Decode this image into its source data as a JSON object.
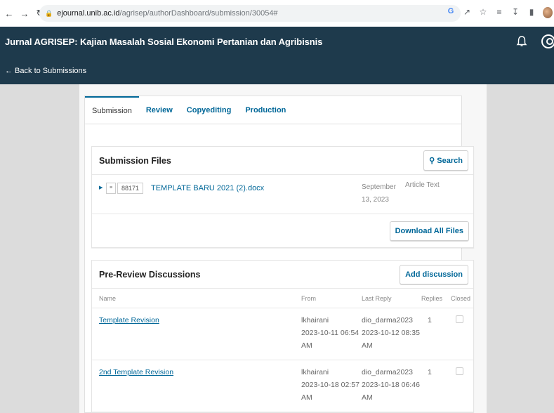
{
  "browser": {
    "url_host": "ejournal.unib.ac.id",
    "url_path": "/agrisep/authorDashboard/submission/30054#"
  },
  "header": {
    "journal_title": "Jurnal AGRISEP: Kajian Masalah Sosial Ekonomi Pertanian dan Agribisnis",
    "back_link": "← Back to Submissions"
  },
  "tabs": [
    {
      "label": "Submission"
    },
    {
      "label": "Review"
    },
    {
      "label": "Copyediting"
    },
    {
      "label": "Production"
    }
  ],
  "files_panel": {
    "title": "Submission Files",
    "search_label": "Search",
    "file": {
      "id": "88171",
      "name": "TEMPLATE BARU 2021 (2).docx",
      "date_line1": "September",
      "date_line2": "13, 2023",
      "type": "Article Text"
    },
    "download_all_label": "Download All Files"
  },
  "discussions": {
    "title": "Pre-Review Discussions",
    "add_label": "Add discussion",
    "columns": {
      "name": "Name",
      "from": "From",
      "last_reply": "Last Reply",
      "replies": "Replies",
      "closed": "Closed"
    },
    "rows": [
      {
        "name": "Template Revision",
        "from_user": "lkhairani",
        "from_date": "2023-10-11 06:54",
        "from_ampm": "AM",
        "reply_user": "dio_darma2023",
        "reply_date": "2023-10-12 08:35",
        "reply_ampm": "AM",
        "replies": "1"
      },
      {
        "name": "2nd Template Revision",
        "from_user": "lkhairani",
        "from_date": "2023-10-18 02:57",
        "from_ampm": "AM",
        "reply_user": "dio_darma2023",
        "reply_date": "2023-10-18 06:46",
        "reply_ampm": "AM",
        "replies": "1"
      }
    ]
  }
}
